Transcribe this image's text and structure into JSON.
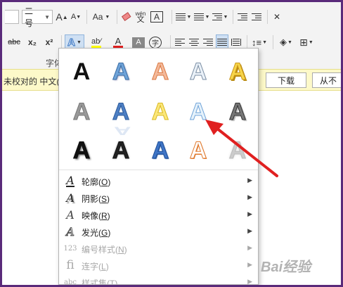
{
  "ribbon": {
    "font_size_value": "二号",
    "grow_font_glyph": "A",
    "shrink_font_glyph": "A",
    "change_case_label": "Aa",
    "phonetic_label": "wén",
    "border_char_glyph": "A",
    "strike_label": "abc",
    "subscript_label": "x₂",
    "superscript_label": "x²",
    "text_effect_glyph": "A",
    "font_color_glyph": "A",
    "shading_glyph": "A",
    "enclose_glyph": "字",
    "font_group_label": "字体"
  },
  "notice": {
    "text": "未校对的 中文(",
    "download_label": "下载",
    "never_label": "从不"
  },
  "text_effects_menu": {
    "gallery_glyph": "A",
    "items": [
      {
        "icon": "A",
        "label": "轮廓(",
        "key": "O",
        "suffix": ")",
        "enabled": true
      },
      {
        "icon": "A",
        "label": "阴影(",
        "key": "S",
        "suffix": ")",
        "enabled": true
      },
      {
        "icon": "A",
        "label": "映像(",
        "key": "R",
        "suffix": ")",
        "enabled": true
      },
      {
        "icon": "A",
        "label": "发光(",
        "key": "G",
        "suffix": ")",
        "enabled": true
      },
      {
        "icon": "123",
        "label": "编号样式(",
        "key": "N",
        "suffix": ")",
        "enabled": false
      },
      {
        "icon": "fi",
        "label": "连字(",
        "key": "L",
        "suffix": ")",
        "enabled": false
      },
      {
        "icon": "abc",
        "label": "样式集(",
        "key": "T",
        "suffix": ")",
        "enabled": false
      }
    ]
  },
  "watermark": "Bai经验",
  "colors": {
    "frame": "#5a2a7a",
    "annotation_arrow": "#e02020",
    "highlight_yellow": "#ffff00",
    "font_red": "#e02020"
  }
}
